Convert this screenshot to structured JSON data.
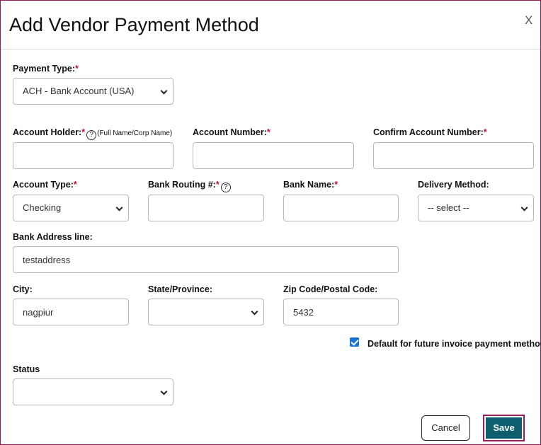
{
  "dialog": {
    "title": "Add Vendor Payment Method",
    "close_label": "X"
  },
  "required_marker": "*",
  "help_glyph": "?",
  "payment_type": {
    "label": "Payment Type:",
    "value": "ACH - Bank Account (USA)"
  },
  "account_holder": {
    "label": "Account Holder:",
    "hint": "(Full Name/Corp Name)",
    "value": ""
  },
  "account_number": {
    "label": "Account Number:",
    "value": ""
  },
  "confirm_account_number": {
    "label": "Confirm Account Number:",
    "value": ""
  },
  "account_type": {
    "label": "Account Type:",
    "value": "Checking"
  },
  "bank_routing": {
    "label": "Bank Routing #:",
    "value": ""
  },
  "bank_name": {
    "label": "Bank Name:",
    "value": ""
  },
  "delivery_method": {
    "label": "Delivery Method:",
    "value": "-- select --"
  },
  "bank_address": {
    "label": "Bank Address line:",
    "value": "testaddress"
  },
  "city": {
    "label": "City:",
    "value": "nagpiur"
  },
  "state": {
    "label": "State/Province:",
    "value": ""
  },
  "zip": {
    "label": "Zip Code/Postal Code:",
    "value": "5432"
  },
  "default_checkbox": {
    "label": "Default for future invoice payment method",
    "checked": true
  },
  "status": {
    "label": "Status",
    "value": ""
  },
  "buttons": {
    "cancel": "Cancel",
    "save": "Save"
  },
  "colors": {
    "accent": "#0d5e6f",
    "focus_border": "#9b1b5a",
    "required": "#c8102e",
    "checkbox": "#1a73d0"
  }
}
